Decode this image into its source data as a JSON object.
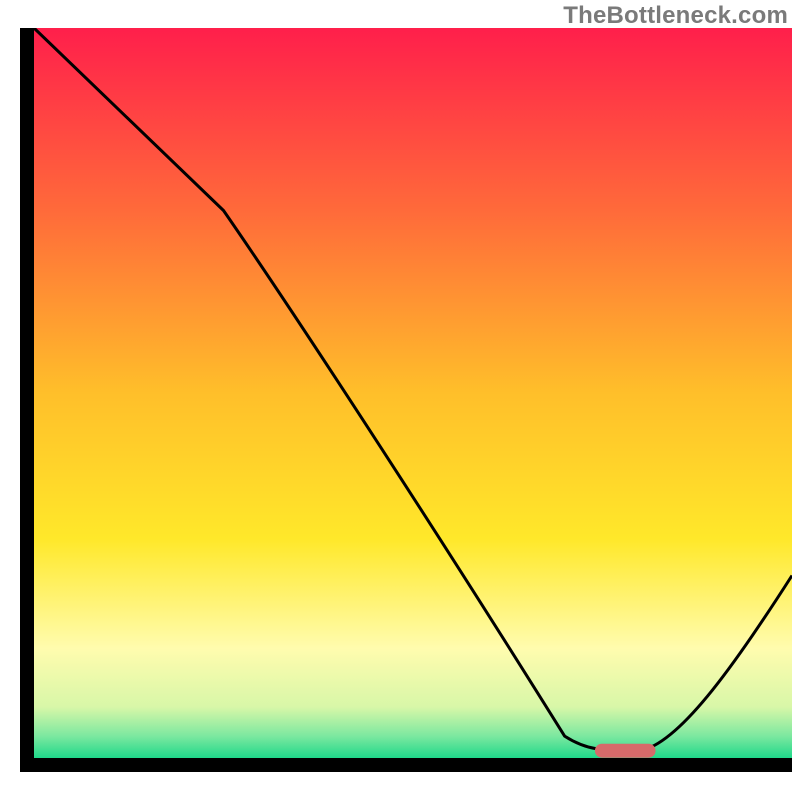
{
  "attribution": "TheBottleneck.com",
  "chart_data": {
    "type": "line",
    "title": "",
    "xlabel": "",
    "ylabel": "",
    "xlim": [
      0,
      100
    ],
    "ylim": [
      0,
      100
    ],
    "grid": false,
    "series": [
      {
        "name": "curve",
        "x": [
          0,
          25,
          70,
          75,
          80,
          100
        ],
        "y": [
          100,
          75,
          3,
          1,
          1,
          25
        ]
      }
    ],
    "marker": {
      "name": "highlight-segment",
      "x_start": 74,
      "x_end": 82,
      "y": 1,
      "color": "#d66a6a"
    },
    "background_gradient": {
      "stops": [
        {
          "offset": 0.0,
          "color": "#ff1f4b"
        },
        {
          "offset": 0.25,
          "color": "#ff6a3a"
        },
        {
          "offset": 0.5,
          "color": "#ffbf2a"
        },
        {
          "offset": 0.7,
          "color": "#ffe82a"
        },
        {
          "offset": 0.85,
          "color": "#fffcae"
        },
        {
          "offset": 0.93,
          "color": "#d8f7a8"
        },
        {
          "offset": 0.97,
          "color": "#7ce8a0"
        },
        {
          "offset": 1.0,
          "color": "#1fd88a"
        }
      ]
    },
    "axis_color": "#000000",
    "curve_color": "#000000"
  }
}
